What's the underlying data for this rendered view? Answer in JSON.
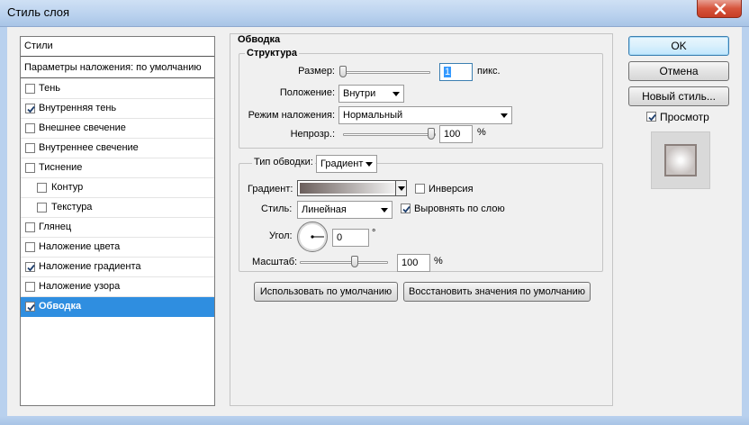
{
  "window": {
    "title": "Стиль слоя"
  },
  "styles_list": {
    "header": "Стили",
    "blending": "Параметры наложения: по умолчанию",
    "items": [
      {
        "label": "Тень",
        "checked": false,
        "indent": false,
        "selected": false
      },
      {
        "label": "Внутренняя тень",
        "checked": true,
        "indent": false,
        "selected": false
      },
      {
        "label": "Внешнее свечение",
        "checked": false,
        "indent": false,
        "selected": false
      },
      {
        "label": "Внутреннее свечение",
        "checked": false,
        "indent": false,
        "selected": false
      },
      {
        "label": "Тиснение",
        "checked": false,
        "indent": false,
        "selected": false
      },
      {
        "label": "Контур",
        "checked": false,
        "indent": true,
        "selected": false
      },
      {
        "label": "Текстура",
        "checked": false,
        "indent": true,
        "selected": false
      },
      {
        "label": "Глянец",
        "checked": false,
        "indent": false,
        "selected": false
      },
      {
        "label": "Наложение цвета",
        "checked": false,
        "indent": false,
        "selected": false
      },
      {
        "label": "Наложение градиента",
        "checked": true,
        "indent": false,
        "selected": false
      },
      {
        "label": "Наложение узора",
        "checked": false,
        "indent": false,
        "selected": false
      },
      {
        "label": "Обводка",
        "checked": true,
        "indent": false,
        "selected": true
      }
    ]
  },
  "stroke": {
    "section_title": "Обводка",
    "structure_title": "Структура",
    "size_label": "Размер:",
    "size_value": "1",
    "size_unit": "пикс.",
    "position_label": "Положение:",
    "position_value": "Внутри",
    "blend_label": "Режим наложения:",
    "blend_value": "Нормальный",
    "opacity_label": "Непрозр.:",
    "opacity_value": "100",
    "opacity_unit": "%",
    "fill_type_label": "Тип обводки:",
    "fill_type_value": "Градиент",
    "gradient_label": "Градиент:",
    "reverse_label": "Инверсия",
    "reverse_checked": false,
    "style_label": "Стиль:",
    "style_value": "Линейная",
    "align_label": "Выровнять по слою",
    "align_checked": true,
    "angle_label": "Угол:",
    "angle_value": "0",
    "angle_unit": "°",
    "scale_label": "Масштаб:",
    "scale_value": "100",
    "scale_unit": "%",
    "make_default_label": "Использовать по умолчанию",
    "reset_default_label": "Восстановить значения по умолчанию"
  },
  "buttons": {
    "ok": "OK",
    "cancel": "Отмена",
    "new_style": "Новый стиль...",
    "preview_label": "Просмотр",
    "preview_checked": true
  },
  "colors": {
    "selection": "#2f8ee0",
    "gradient_start": "#6b5f5c",
    "gradient_end": "#f2f2f2"
  }
}
